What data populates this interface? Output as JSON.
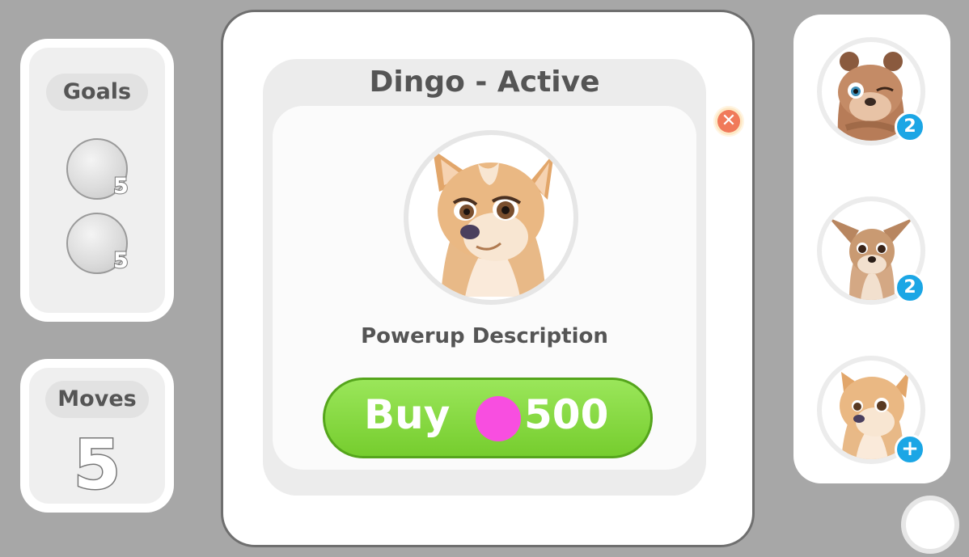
{
  "goals": {
    "label": "Goals",
    "items": [
      {
        "icon": "grey-ball-icon",
        "count": "5"
      },
      {
        "icon": "grey-ball-icon",
        "count": "5"
      }
    ]
  },
  "moves": {
    "label": "Moves",
    "value": "5"
  },
  "dialog": {
    "title": "Dingo - Active",
    "character": "dingo",
    "description": "Powerup Description",
    "buy_label": "Buy",
    "price": "500",
    "currency_icon": "pink-coin-icon",
    "close_icon": "close-icon"
  },
  "characters": [
    {
      "name": "wombat",
      "badge": "2"
    },
    {
      "name": "kangaroo",
      "badge": "2"
    },
    {
      "name": "dingo",
      "badge": "+"
    }
  ],
  "colors": {
    "background": "#a7a7a7",
    "buy_button": "#85d93c",
    "coin": "#f84ee0",
    "badge": "#1ba6e5",
    "close": "#f07a5a"
  }
}
